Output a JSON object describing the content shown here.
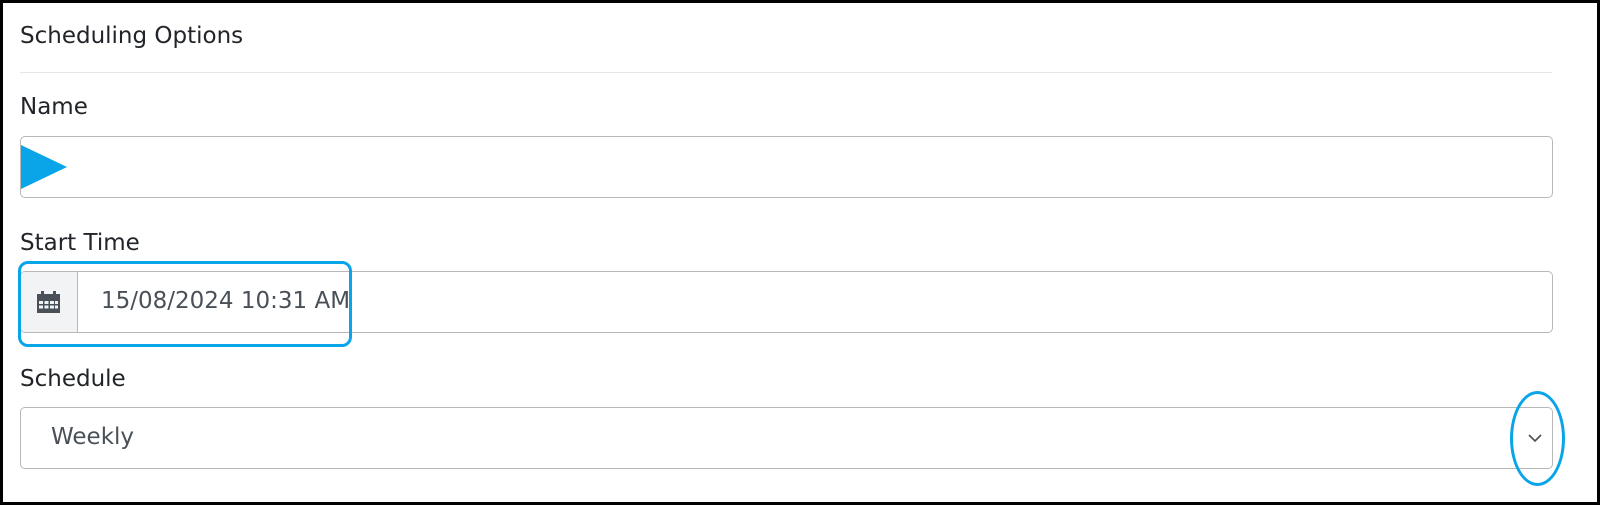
{
  "panel": {
    "title": "Scheduling Options"
  },
  "form": {
    "name": {
      "label": "Name",
      "value": ""
    },
    "start_time": {
      "label": "Start Time",
      "value": "15/08/2024 10:31 AM"
    },
    "schedule": {
      "label": "Schedule",
      "selected": "Weekly"
    }
  },
  "icons": {
    "play": "play-triangle-icon",
    "calendar": "calendar-icon",
    "chevron": "chevron-down-icon"
  },
  "colors": {
    "accent": "#0aa5e8",
    "text": "#212529",
    "input_text": "#495057",
    "border": "#b8b8b8",
    "addon_bg": "#f1f3f5"
  }
}
